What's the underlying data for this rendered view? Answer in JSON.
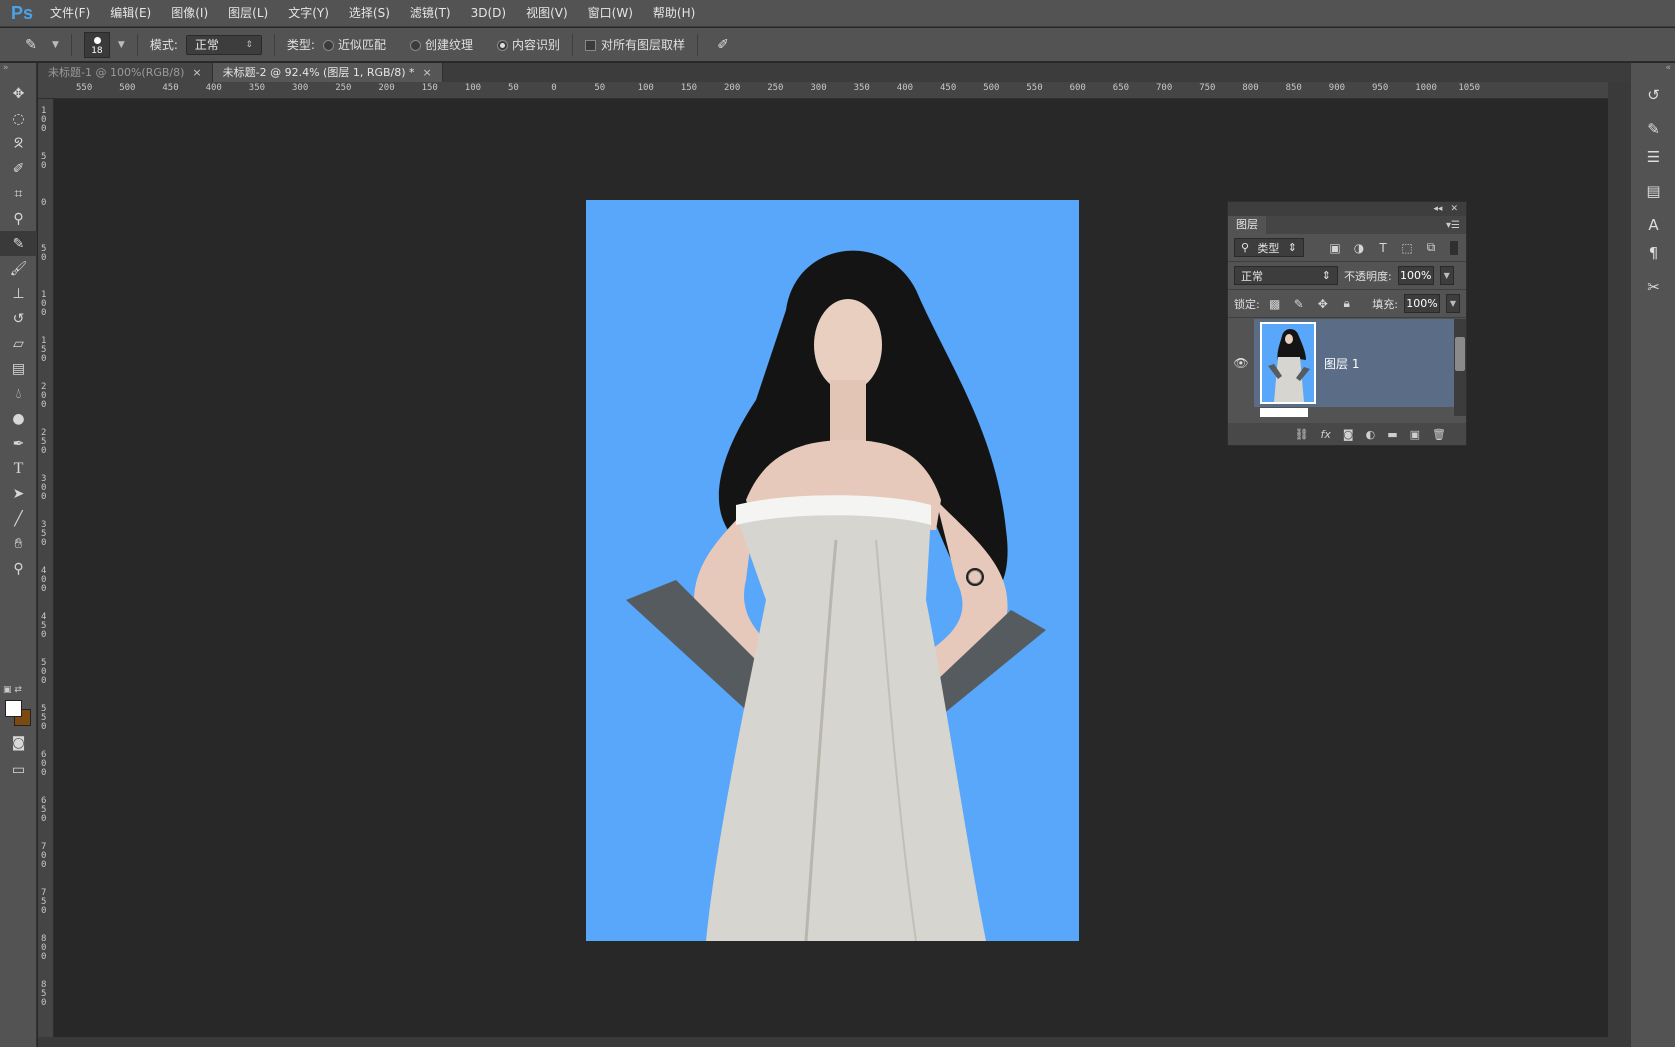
{
  "app": {
    "logo": "Ps"
  },
  "menu": [
    "文件(F)",
    "编辑(E)",
    "图像(I)",
    "图层(L)",
    "文字(Y)",
    "选择(S)",
    "滤镜(T)",
    "3D(D)",
    "视图(V)",
    "窗口(W)",
    "帮助(H)"
  ],
  "options": {
    "brush_size": "18",
    "mode_label": "模式:",
    "mode_value": "正常",
    "type_label": "类型:",
    "radio_proximity": "近似匹配",
    "radio_texture": "创建纹理",
    "radio_content": "内容识别",
    "sample_all": "对所有图层取样",
    "selected_radio": "内容识别"
  },
  "tabs": [
    {
      "label": "未标题-1 @ 100%(RGB/8)",
      "close": "×",
      "active": false
    },
    {
      "label": "未标题-2 @ 92.4% (图层 1, RGB/8) *",
      "close": "×",
      "active": true
    }
  ],
  "ruler_top": [
    "550",
    "500",
    "450",
    "400",
    "350",
    "300",
    "250",
    "200",
    "150",
    "100",
    "50",
    "0",
    "50",
    "100",
    "150",
    "200",
    "250",
    "300",
    "350",
    "400",
    "450",
    "500",
    "550",
    "600",
    "650",
    "700",
    "750",
    "800",
    "850",
    "900",
    "950",
    "1000",
    "1050"
  ],
  "ruler_left": [
    "1\n0\n0",
    "5\n0",
    "0",
    "5\n0",
    "1\n0\n0",
    "1\n5\n0",
    "2\n0\n0",
    "2\n5\n0",
    "3\n0\n0",
    "3\n5\n0",
    "4\n0\n0",
    "4\n5\n0",
    "5\n0\n0",
    "5\n5\n0",
    "6\n0\n0",
    "6\n5\n0",
    "7\n0\n0",
    "7\n5\n0",
    "8\n0\n0",
    "8\n5\n0"
  ],
  "layers_panel": {
    "tab": "图层",
    "filter": "类型",
    "blend_mode": "正常",
    "opacity_label": "不透明度:",
    "opacity": "100%",
    "lock_label": "锁定:",
    "fill_label": "填充:",
    "fill": "100%",
    "layer_name": "图层 1"
  },
  "colors": {
    "accent": "#4aa3e8",
    "canvas_bg": "#58a7fb",
    "fg_swatch": "#ffffff",
    "bg_swatch": "#7a4a12"
  }
}
